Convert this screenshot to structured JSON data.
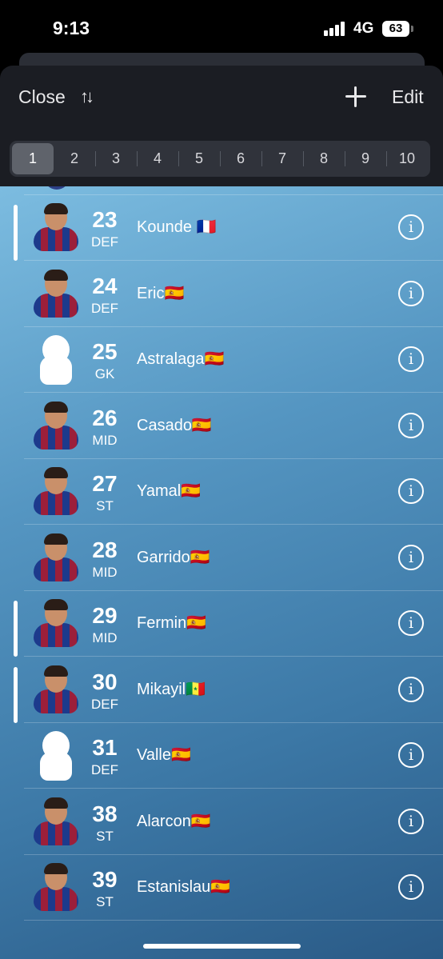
{
  "status_bar": {
    "time": "9:13",
    "network": "4G",
    "battery": "63"
  },
  "header": {
    "close_label": "Close",
    "sort_icon": "↑↓",
    "edit_label": "Edit"
  },
  "segments": {
    "active": "1",
    "items": [
      "1",
      "2",
      "3",
      "4",
      "5",
      "6",
      "7",
      "8",
      "9",
      "10"
    ]
  },
  "players": [
    {
      "number": "23",
      "position": "DEF",
      "name": "Kounde 🇫🇷",
      "marked": true,
      "placeholder": false
    },
    {
      "number": "24",
      "position": "DEF",
      "name": "Eric🇪🇸",
      "marked": false,
      "placeholder": false
    },
    {
      "number": "25",
      "position": "GK",
      "name": "Astralaga🇪🇸",
      "marked": false,
      "placeholder": true
    },
    {
      "number": "26",
      "position": "MID",
      "name": "Casado🇪🇸",
      "marked": false,
      "placeholder": false
    },
    {
      "number": "27",
      "position": "ST",
      "name": "Yamal🇪🇸",
      "marked": false,
      "placeholder": false
    },
    {
      "number": "28",
      "position": "MID",
      "name": "Garrido🇪🇸",
      "marked": false,
      "placeholder": false
    },
    {
      "number": "29",
      "position": "MID",
      "name": "Fermin🇪🇸",
      "marked": true,
      "placeholder": false
    },
    {
      "number": "30",
      "position": "DEF",
      "name": "Mikayil🇸🇳",
      "marked": true,
      "placeholder": false
    },
    {
      "number": "31",
      "position": "DEF",
      "name": "Valle🇪🇸",
      "marked": false,
      "placeholder": true
    },
    {
      "number": "38",
      "position": "ST",
      "name": "Alarcon🇪🇸",
      "marked": false,
      "placeholder": false
    },
    {
      "number": "39",
      "position": "ST",
      "name": "Estanislau🇪🇸",
      "marked": false,
      "placeholder": false
    }
  ],
  "colors": {
    "header_bg": "#1b1d23",
    "list_gradient_start": "#7cbce0",
    "list_gradient_end": "#2a5a86"
  }
}
